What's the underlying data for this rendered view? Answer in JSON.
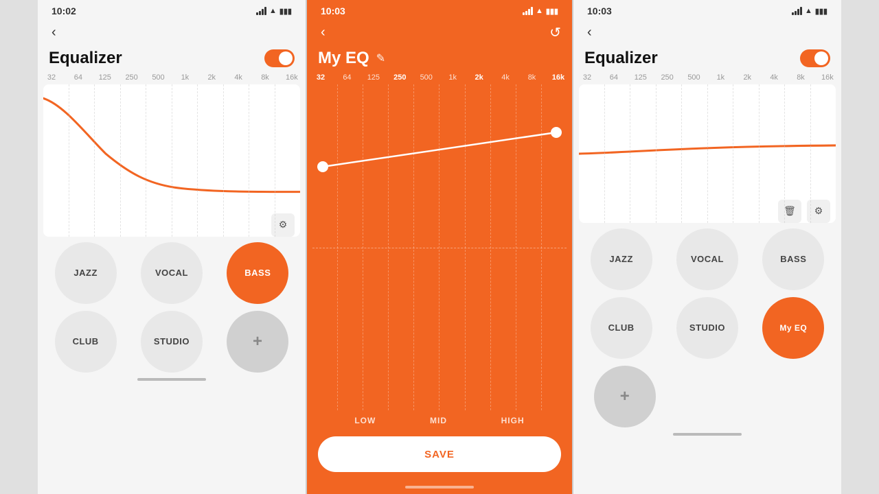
{
  "screen1": {
    "status_time": "10:02",
    "title": "Equalizer",
    "toggle_on": true,
    "freq_labels": [
      "32",
      "64",
      "125",
      "250",
      "500",
      "1k",
      "2k",
      "4k",
      "8k",
      "16k"
    ],
    "presets_row1": [
      {
        "label": "JAZZ",
        "active": false
      },
      {
        "label": "VOCAL",
        "active": false
      },
      {
        "label": "BASS",
        "active": true
      }
    ],
    "presets_row2": [
      {
        "label": "CLUB",
        "active": false
      },
      {
        "label": "STUDIO",
        "active": false
      },
      {
        "label": "+",
        "type": "add"
      }
    ]
  },
  "screen2": {
    "status_time": "10:03",
    "title": "My EQ",
    "freq_labels": [
      "32",
      "64",
      "125",
      "250",
      "500",
      "1k",
      "2k",
      "4k",
      "8k",
      "16k"
    ],
    "eq_labels": [
      "LOW",
      "MID",
      "HIGH"
    ],
    "save_label": "SAVE"
  },
  "screen3": {
    "status_time": "10:03",
    "title": "Equalizer",
    "toggle_on": true,
    "freq_labels": [
      "32",
      "64",
      "125",
      "250",
      "500",
      "1k",
      "2k",
      "4k",
      "8k",
      "16k"
    ],
    "presets_row1": [
      {
        "label": "JAZZ",
        "active": false
      },
      {
        "label": "VOCAL",
        "active": false
      },
      {
        "label": "BASS",
        "active": false
      }
    ],
    "presets_row2": [
      {
        "label": "CLUB",
        "active": false
      },
      {
        "label": "STUDIO",
        "active": false
      },
      {
        "label": "My EQ",
        "active": true,
        "type": "my-eq"
      }
    ],
    "presets_row3": [
      {
        "label": "+",
        "type": "add"
      }
    ]
  },
  "icons": {
    "back": "‹",
    "reset": "↺",
    "edit": "⊘",
    "gear": "⚙",
    "delete": "🗑",
    "plus": "+"
  }
}
